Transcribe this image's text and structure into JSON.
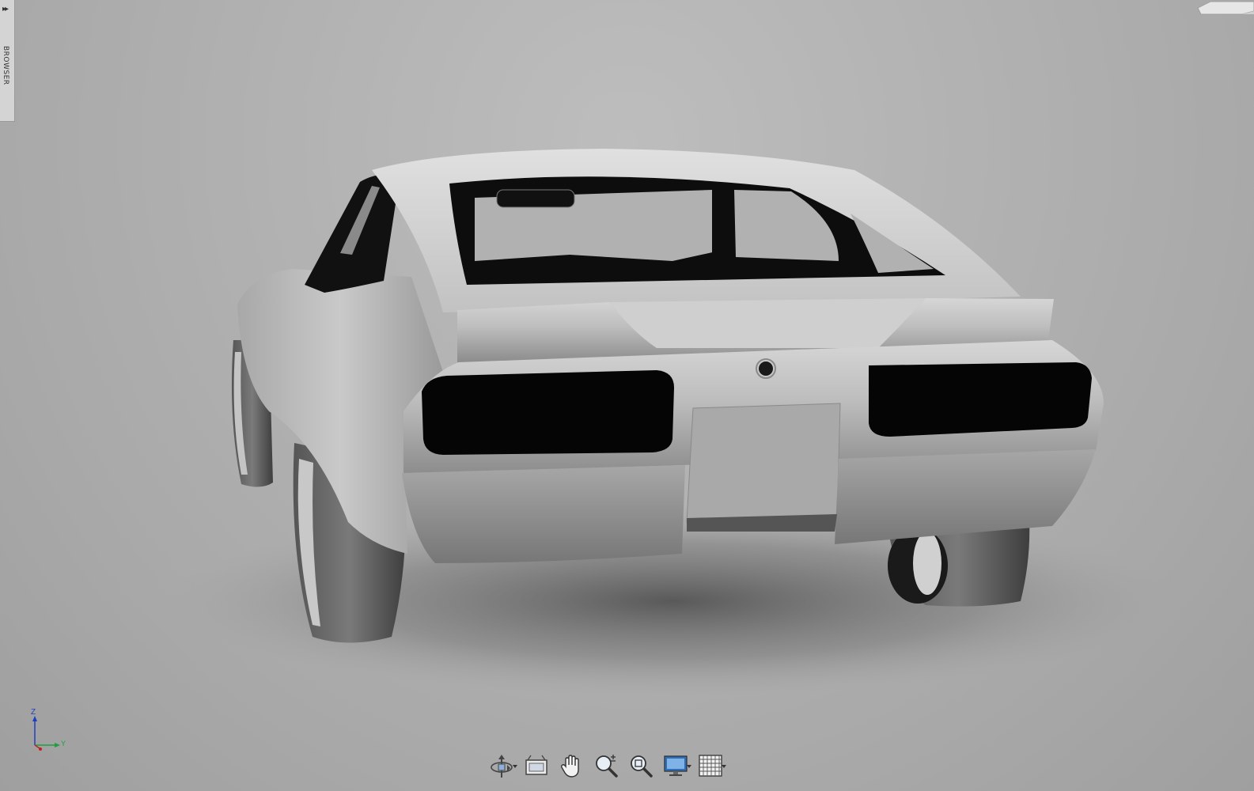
{
  "browser": {
    "label": "BROWSER",
    "expand_glyph": "▸▸"
  },
  "triad": {
    "z_label": "Z",
    "y_label": "Y"
  },
  "toolbar": {
    "tools": [
      {
        "icon": "orbit-icon",
        "has_dropdown": true
      },
      {
        "icon": "look-at-icon",
        "has_dropdown": false
      },
      {
        "icon": "pan-hand-icon",
        "has_dropdown": false
      },
      {
        "icon": "zoom-icon",
        "has_dropdown": false
      },
      {
        "icon": "fit-icon",
        "has_dropdown": false
      },
      {
        "icon": "display-settings-icon",
        "has_dropdown": true
      },
      {
        "icon": "grid-snap-icon",
        "has_dropdown": true
      }
    ]
  },
  "colors": {
    "background": "#b3b3b3",
    "car_body": "#b8b8b8",
    "glass": "#0a0a0a",
    "axis_z": "#1f3fbf",
    "axis_y": "#1f9f3f",
    "axis_x": "#c02020"
  }
}
